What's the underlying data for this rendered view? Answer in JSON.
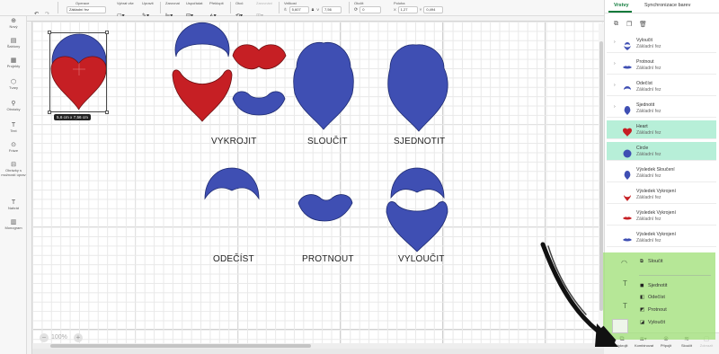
{
  "toolbar": {
    "undo_icon": "undo-icon",
    "redo_icon": "redo-icon",
    "operation_label": "Operace",
    "operation_value": "Základní řez",
    "select_color_label": "Vybrat  vše",
    "edit_label": "Upravit",
    "align_label": "Zarovnat",
    "distribute_label": "Uspořádat",
    "flip_label": "Překlopit",
    "rotate_label": "Otoč",
    "size_label": "Velikost",
    "width_prefix": "Š",
    "width_value": "5,607",
    "height_prefix": "V",
    "height_value": "7,56",
    "rotation_label": "Otočit",
    "rotation_value": "0",
    "position_label": "Poloha",
    "x_prefix": "X",
    "x_value": "1,27",
    "y_prefix": "Y",
    "y_value": "0,494",
    "disabled_label": "Zarovnání"
  },
  "left_rail": [
    {
      "icon": "new-project-icon",
      "label": "Nový"
    },
    {
      "icon": "templates-icon",
      "label": "Šablony"
    },
    {
      "icon": "projects-icon",
      "label": "Projekty"
    },
    {
      "icon": "shapes-icon",
      "label": "Tvary"
    },
    {
      "icon": "images-icon",
      "label": "Obrázky"
    },
    {
      "icon": "text-icon",
      "label": "Text"
    },
    {
      "icon": "phrases-icon",
      "label": "Fráze"
    },
    {
      "icon": "editable-images-icon",
      "label": "Obrázky s možností úprav"
    },
    {
      "icon": "text-tool-icon",
      "label": "Nahrát"
    },
    {
      "icon": "monogram-icon",
      "label": "Monogram"
    }
  ],
  "shape_labels": {
    "slice": "VYKROJIT",
    "weld": "SLOUČIT",
    "unite": "SJEDNOTIT",
    "subtract": "ODEČÍST",
    "intersect": "PROTNOUT",
    "exclude": "VYLOUČIT"
  },
  "selection_size": "5,6  cm x 7,56  cm",
  "zoom_level": "100%",
  "colors": {
    "blue": "#3f4fb3",
    "red": "#c61f24",
    "accent_green": "#0f7a3b",
    "selected_row": "#b7efd8",
    "menu_highlight": "#a2e07a"
  },
  "panel": {
    "tab_layers": "Vrstvy",
    "tab_colors": "Synchronizace barev",
    "layers": [
      {
        "name": "Vyloučit",
        "sub": "Základní řez",
        "thumb": "exclude-shape",
        "caret": true,
        "selected": false
      },
      {
        "name": "Protnout",
        "sub": "Základní řez",
        "thumb": "intersect-shape",
        "caret": true,
        "selected": false
      },
      {
        "name": "Odečíst",
        "sub": "Základní řez",
        "thumb": "subtract-shape",
        "caret": true,
        "selected": false
      },
      {
        "name": "Sjednotit",
        "sub": "Základní řez",
        "thumb": "unite-shape",
        "caret": true,
        "selected": false
      },
      {
        "name": "Heart",
        "sub": "Základní řez",
        "thumb": "heart-shape",
        "caret": false,
        "selected": true
      },
      {
        "name": "Circle",
        "sub": "Základní řez",
        "thumb": "circle-shape",
        "caret": false,
        "selected": true
      },
      {
        "name": "Výsledek Sloučení",
        "sub": "Základní řez",
        "thumb": "weld-shape",
        "caret": false,
        "selected": false
      },
      {
        "name": "Výsledek Vykrojení",
        "sub": "Základní řez",
        "thumb": "slice-red-shape",
        "caret": false,
        "selected": false
      },
      {
        "name": "Výsledek Vykrojení",
        "sub": "Základní řez",
        "thumb": "slice-red2-shape",
        "caret": false,
        "selected": false
      },
      {
        "name": "Výsledek Vykrojení",
        "sub": "Základní řez",
        "thumb": "slice-blue-shape",
        "caret": false,
        "selected": false
      }
    ]
  },
  "combine_menu": {
    "weld": "Sloučit",
    "unite": "Sjednotit",
    "subtract": "Odečíst",
    "intersect": "Protnout",
    "exclude": "Vyloučit"
  },
  "actions": {
    "slice": "Vykrojit",
    "combine": "Kombinovat",
    "attach": "Připojit",
    "flatten": "Sloučit",
    "more": "Zobrazit"
  }
}
